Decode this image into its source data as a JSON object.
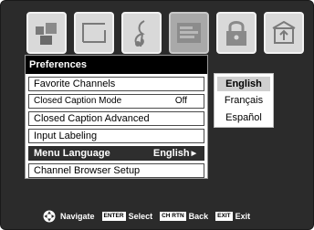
{
  "tabs": [
    {
      "icon": "picture-icon"
    },
    {
      "icon": "screen-size-icon"
    },
    {
      "icon": "audio-note-icon"
    },
    {
      "icon": "preferences-icon"
    },
    {
      "icon": "lock-icon"
    },
    {
      "icon": "setup-icon"
    }
  ],
  "active_tab": "preferences-icon",
  "panel": {
    "title": "Preferences",
    "items": [
      {
        "label": "Favorite Channels",
        "value": ""
      },
      {
        "label": "Closed Caption Mode",
        "value": "Off"
      },
      {
        "label": "Closed Caption Advanced",
        "value": ""
      },
      {
        "label": "Input Labeling",
        "value": ""
      },
      {
        "label": "Menu Language",
        "value": "English",
        "selected": true
      },
      {
        "label": "Channel Browser Setup",
        "value": ""
      }
    ]
  },
  "submenu": {
    "options": [
      "English",
      "Français",
      "Español"
    ],
    "current": "English"
  },
  "help": {
    "navigate_label": "Navigate",
    "enter_key": "ENTER",
    "select_label": "Select",
    "chrtn_key": "CH RTN",
    "back_label": "Back",
    "exit_key": "EXIT",
    "exit_label": "Exit"
  },
  "colors": {
    "background": "#2b2b2b",
    "tile": "#d9d9d9",
    "tile_active": "#a9a9a9",
    "selected_row": "#2e2e2e",
    "submenu_current": "#cfcfcf"
  }
}
